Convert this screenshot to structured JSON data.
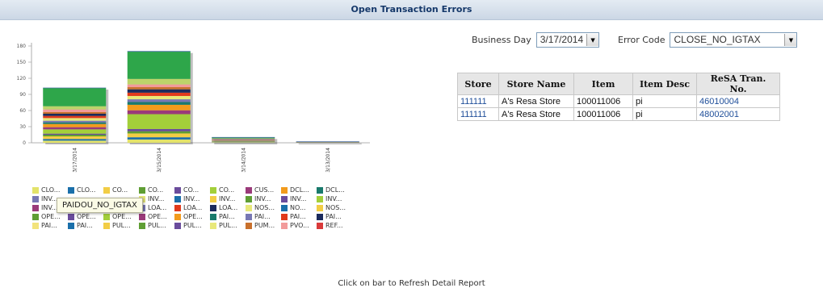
{
  "title": "Open Transaction Errors",
  "filters": {
    "business_day_label": "Business Day",
    "business_day_value": "3/17/2014",
    "error_code_label": "Error Code",
    "error_code_value": "CLOSE_NO_IGTAX"
  },
  "tooltip": "PAIDOU_NO_IGTAX",
  "table": {
    "headers": [
      "Store",
      "Store Name",
      "Item",
      "Item Desc",
      "ReSA Tran. No."
    ],
    "rows": [
      [
        "111111",
        "A's Resa Store",
        "100011006",
        "pi",
        "46010004"
      ],
      [
        "111111",
        "A's Resa Store",
        "100011006",
        "pi",
        "48002001"
      ]
    ]
  },
  "footer": "Click on bar to Refresh Detail Report",
  "legend": [
    [
      {
        "label": "CLO...",
        "color": "#e3e36a"
      },
      {
        "label": "CLO...",
        "color": "#1a6faa"
      },
      {
        "label": "CO...",
        "color": "#f2cd45"
      },
      {
        "label": "CO...",
        "color": "#5f9e34"
      },
      {
        "label": "CO...",
        "color": "#6a4c9c"
      },
      {
        "label": "CO...",
        "color": "#a3cf3a"
      },
      {
        "label": "CUS...",
        "color": "#9a3a7a"
      },
      {
        "label": "DCL...",
        "color": "#f29b1c"
      },
      {
        "label": "DCL...",
        "color": "#197a6c"
      }
    ],
    [
      {
        "label": "INV...",
        "color": "#7878b4"
      },
      {
        "label": "",
        "color": "#ffffff"
      },
      {
        "label": "",
        "color": "#ffffff"
      },
      {
        "label": "INV...",
        "color": "#e8e87a"
      },
      {
        "label": "INV...",
        "color": "#1a6faa"
      },
      {
        "label": "INV...",
        "color": "#f2cd45"
      },
      {
        "label": "INV...",
        "color": "#5f9e34"
      },
      {
        "label": "INV...",
        "color": "#6a4c9c"
      },
      {
        "label": "INV...",
        "color": "#a3cf3a"
      }
    ],
    [
      {
        "label": "INV...",
        "color": "#9a3a7a"
      },
      {
        "label": "",
        "color": "#ffffff"
      },
      {
        "label": "",
        "color": "#ffffff"
      },
      {
        "label": "LOA...",
        "color": "#7878b4"
      },
      {
        "label": "LOA...",
        "color": "#e03a1c"
      },
      {
        "label": "LOA...",
        "color": "#1b2a5c"
      },
      {
        "label": "NOS...",
        "color": "#e8e87a"
      },
      {
        "label": "NO...",
        "color": "#1a6faa"
      },
      {
        "label": "NOS...",
        "color": "#f2cd45"
      }
    ],
    [
      {
        "label": "OPE...",
        "color": "#5f9e34"
      },
      {
        "label": "OPE...",
        "color": "#6a4c9c"
      },
      {
        "label": "OPE...",
        "color": "#a3cf3a"
      },
      {
        "label": "OPE...",
        "color": "#9a3a7a"
      },
      {
        "label": "OPE...",
        "color": "#f29b1c"
      },
      {
        "label": "PAI...",
        "color": "#197a6c"
      },
      {
        "label": "PAI...",
        "color": "#7878b4"
      },
      {
        "label": "PAI...",
        "color": "#e03a1c"
      },
      {
        "label": "PAI...",
        "color": "#1b2a5c"
      }
    ],
    [
      {
        "label": "PAI...",
        "color": "#f2e37a"
      },
      {
        "label": "PAI...",
        "color": "#1a6faa"
      },
      {
        "label": "PUL...",
        "color": "#f2cd45"
      },
      {
        "label": "PUL...",
        "color": "#5f9e34"
      },
      {
        "label": "PUL...",
        "color": "#6a4c9c"
      },
      {
        "label": "PUL...",
        "color": "#e8e87a"
      },
      {
        "label": "PUM...",
        "color": "#c8702c"
      },
      {
        "label": "PVO...",
        "color": "#f29b9b"
      },
      {
        "label": "REF...",
        "color": "#d93a3a"
      }
    ]
  ],
  "chart_data": {
    "type": "bar",
    "stacked": true,
    "categories": [
      "3/17/2014",
      "3/15/2014",
      "3/14/2014",
      "3/13/2014"
    ],
    "y_ticks": [
      0,
      30,
      60,
      90,
      120,
      150,
      180
    ],
    "ylim": [
      0,
      180
    ],
    "grid": false,
    "totals": [
      102,
      170,
      10,
      2
    ],
    "series": [
      {
        "color": "#e3e36a",
        "values": [
          4,
          6,
          0.6,
          0.3
        ]
      },
      {
        "color": "#1a6faa",
        "values": [
          3,
          4,
          0.6,
          0.2
        ]
      },
      {
        "color": "#f2cd45",
        "values": [
          5,
          7,
          0.6,
          0.2
        ]
      },
      {
        "color": "#5f9e34",
        "values": [
          3,
          4,
          0.6,
          0.1
        ]
      },
      {
        "color": "#6a4c9c",
        "values": [
          2,
          4,
          0.5,
          0.1
        ]
      },
      {
        "color": "#a3cf3a",
        "values": [
          8,
          27,
          0.6,
          0.1
        ]
      },
      {
        "color": "#9a3a7a",
        "values": [
          4,
          7,
          0.5,
          0.1
        ]
      },
      {
        "color": "#f29b1c",
        "values": [
          6,
          10,
          0.5,
          0.1
        ]
      },
      {
        "color": "#197a6c",
        "values": [
          3,
          5,
          0.5,
          0.1
        ]
      },
      {
        "color": "#7878b4",
        "values": [
          3,
          5,
          0.5,
          0.1
        ]
      },
      {
        "color": "#e8e87a",
        "values": [
          5,
          6,
          0.5,
          0.1
        ]
      },
      {
        "color": "#e03a1c",
        "values": [
          4,
          6,
          0.5,
          0.1
        ]
      },
      {
        "color": "#1b2a5c",
        "values": [
          4,
          6,
          0.5,
          0.1
        ]
      },
      {
        "color": "#c8702c",
        "values": [
          3,
          4,
          0.5,
          0.1
        ]
      },
      {
        "color": "#f29b9b",
        "values": [
          5,
          5,
          0.5,
          0.1
        ]
      },
      {
        "color": "#bcd46a",
        "values": [
          6,
          10,
          0.5,
          0.1
        ]
      },
      {
        "color": "#2ea64a",
        "values": [
          34,
          50,
          2.0,
          0.0
        ]
      }
    ]
  }
}
